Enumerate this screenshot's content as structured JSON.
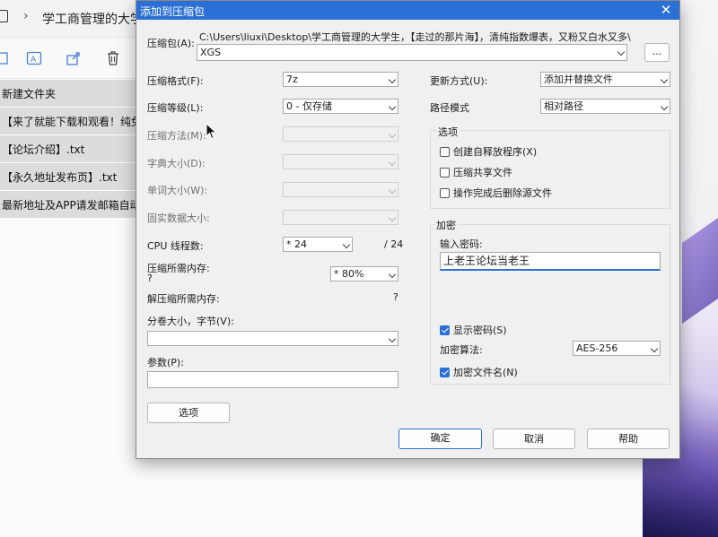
{
  "background": {
    "window_title": "学工商管理的大学生",
    "files": [
      "新建文件夹",
      "【来了就能下载和观看！纯免费",
      "【论坛介绍】.txt",
      "【永久地址发布页】.txt",
      "最新地址及APP请发邮箱自动获"
    ]
  },
  "dialog": {
    "title": "添加到压缩包",
    "close_glyph": "✕",
    "archive_label": "压缩包(A):",
    "archive_path": "C:\\Users\\liuxi\\Desktop\\学工商管理的大学生，【走过的那片海】，清纯指数爆表，又粉又白水又多\\",
    "archive_name": "XGS",
    "browse_label": "...",
    "left": {
      "format_label": "压缩格式(F):",
      "format_value": "7z",
      "level_label": "压缩等级(L):",
      "level_value": "0 - 仅存储",
      "method_label": "压缩方法(M):",
      "dict_label": "字典大小(D):",
      "word_label": "单词大小(W):",
      "solid_label": "固实数据大小:",
      "cpu_label": "CPU 线程数:",
      "cpu_value": "* 24",
      "cpu_total": "/ 24",
      "mem_compress_label": "压缩所需内存:",
      "mem_compress_q": "?",
      "mem_percent": "* 80%",
      "mem_decompress_label": "解压缩所需内存:",
      "mem_decompress_q": "?",
      "volume_label": "分卷大小，字节(V):",
      "volume_value": "",
      "params_label": "参数(P):",
      "params_value": "",
      "options_button": "选项"
    },
    "right": {
      "update_label": "更新方式(U):",
      "update_value": "添加并替换文件",
      "path_label": "路径模式",
      "path_value": "相对路径",
      "options_group": "选项",
      "opt_sfx": "创建自释放程序(X)",
      "opt_shared": "压缩共享文件",
      "opt_delete": "操作完成后删除源文件",
      "encrypt_group": "加密",
      "password_label": "输入密码:",
      "password_value": "上老王论坛当老王",
      "show_password": "显示密码(S)",
      "algo_label": "加密算法:",
      "algo_value": "AES-256",
      "encrypt_names": "加密文件名(N)"
    },
    "buttons": {
      "ok": "确定",
      "cancel": "取消",
      "help": "帮助"
    }
  }
}
